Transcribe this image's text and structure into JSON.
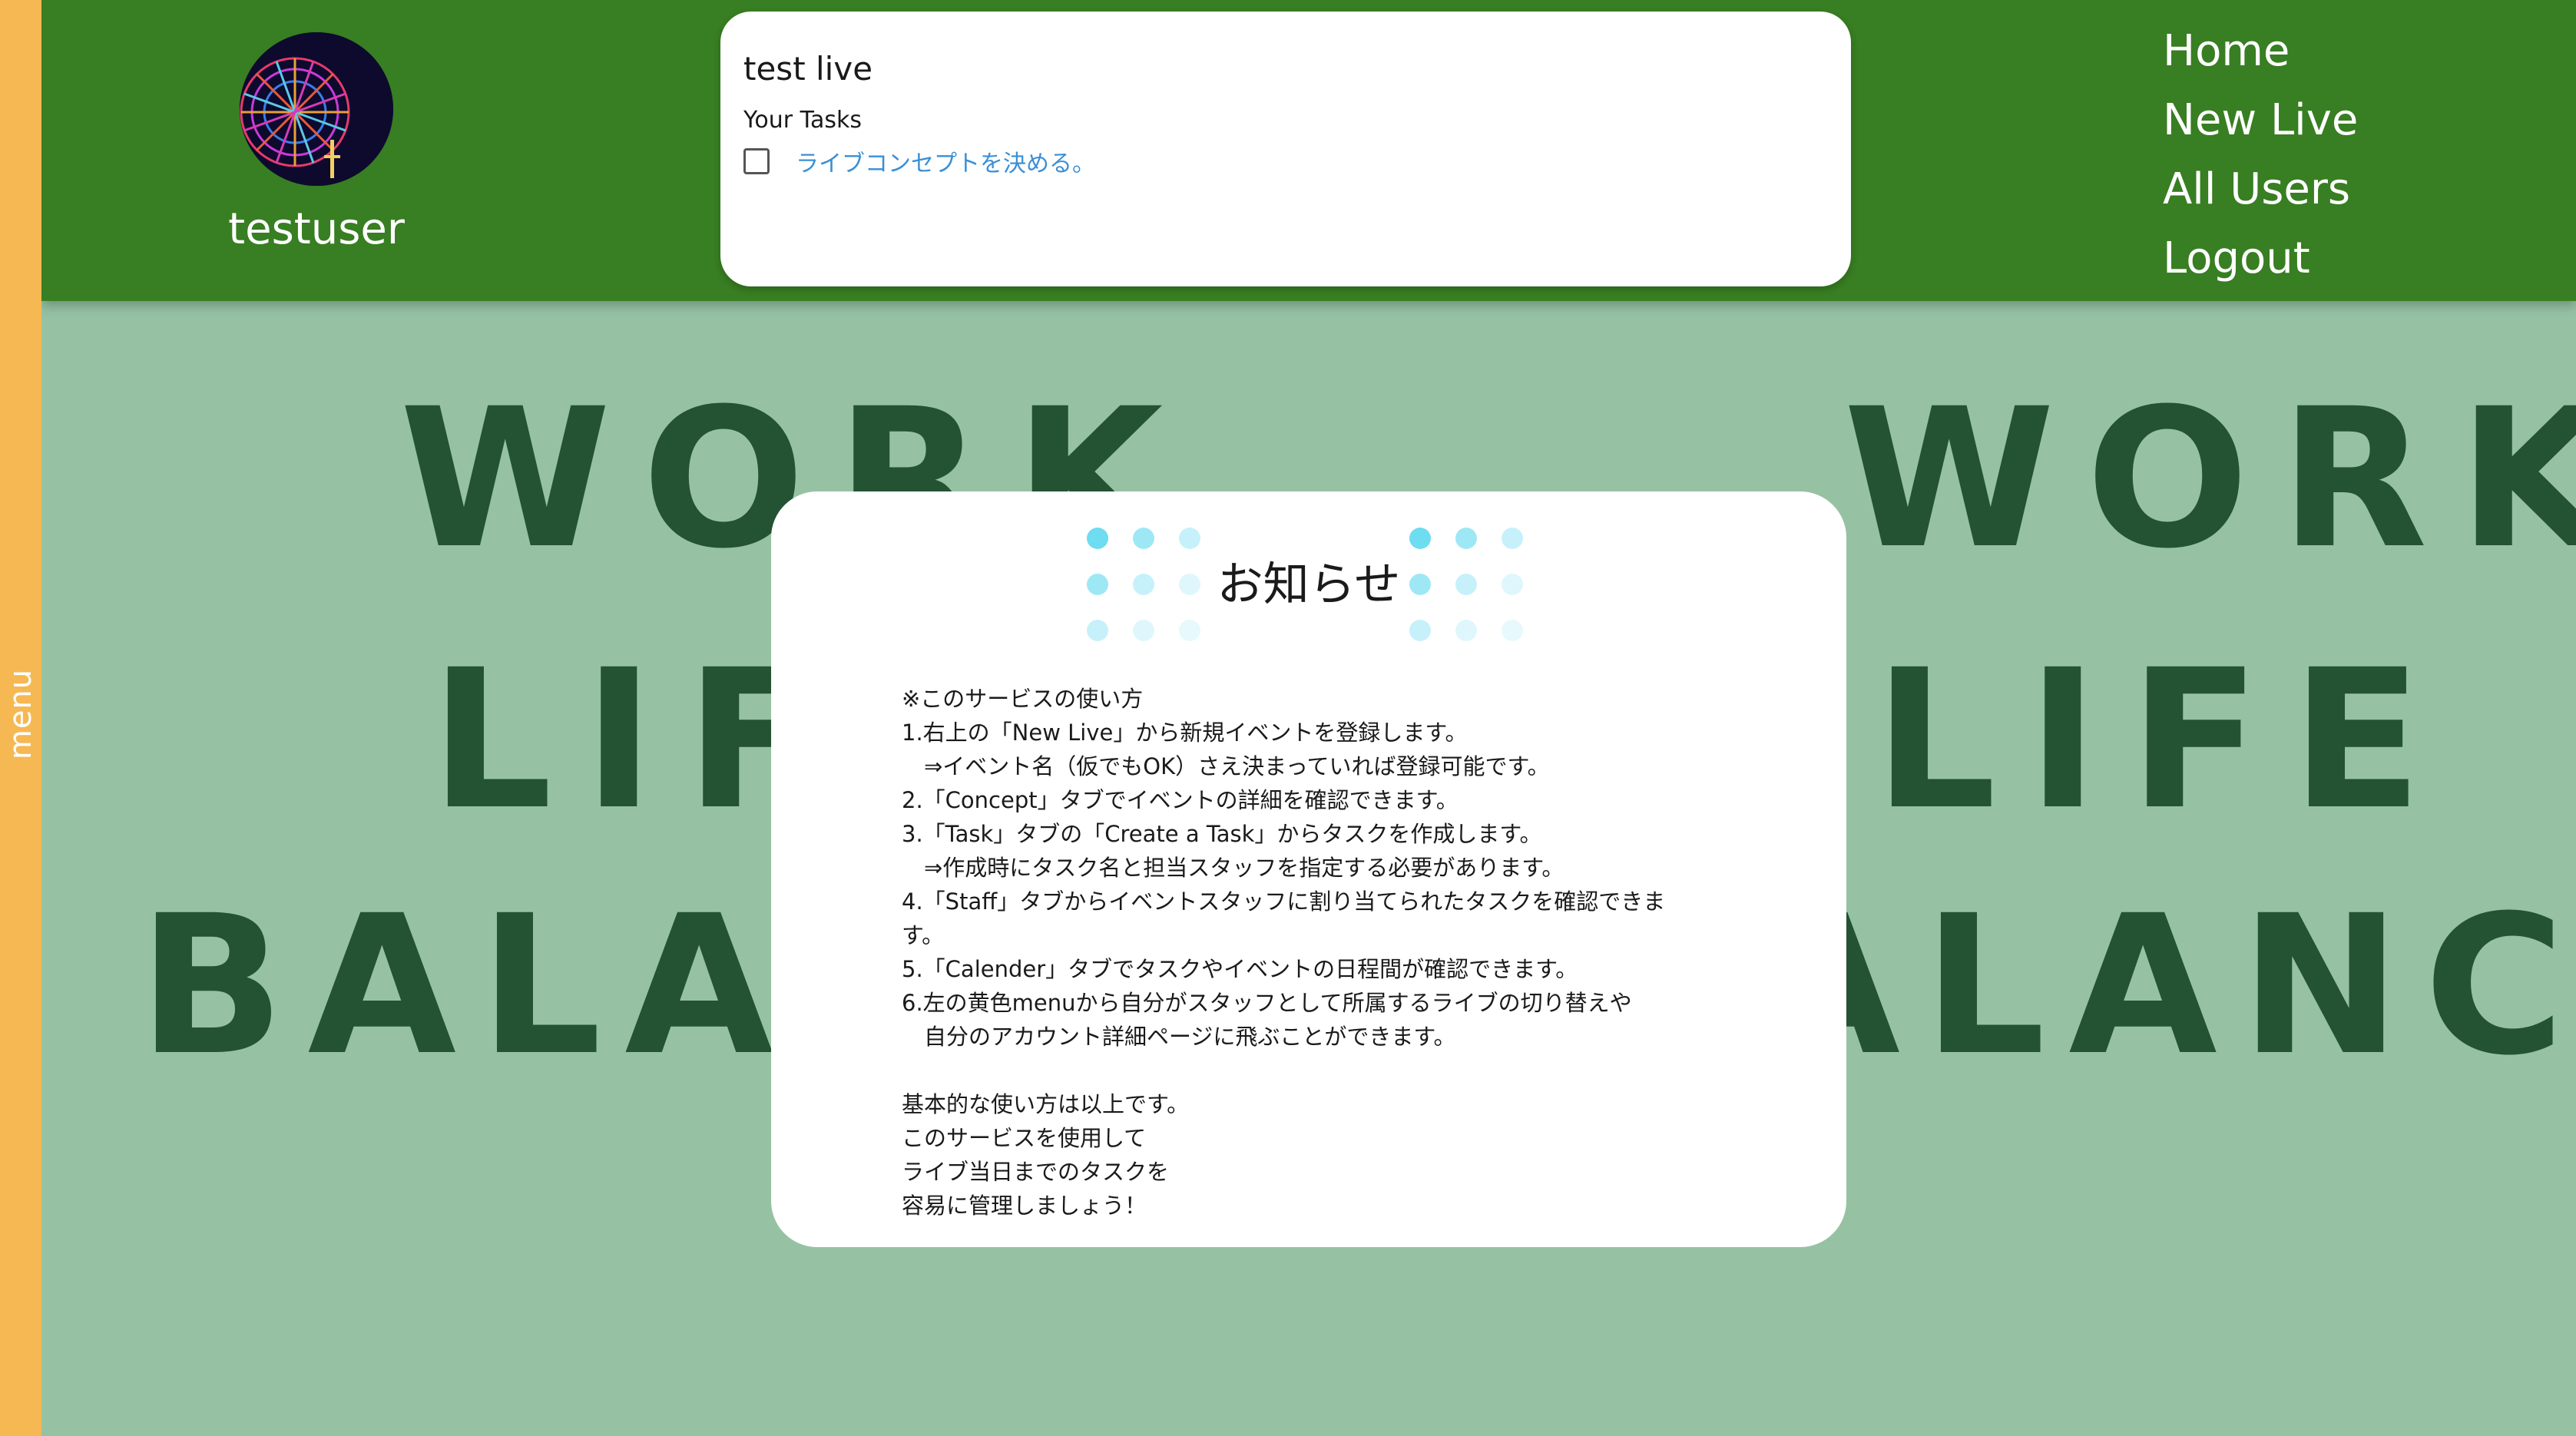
{
  "sidebar": {
    "menu_label": "menu",
    "color": "#f6b853"
  },
  "header": {
    "background": "#387e22",
    "username": "testuser",
    "nav": [
      {
        "label": "Home"
      },
      {
        "label": "New Live"
      },
      {
        "label": "All Users"
      },
      {
        "label": "Logout"
      }
    ]
  },
  "live_card": {
    "title": "test live",
    "tasks_heading": "Your Tasks",
    "tasks": [
      {
        "label": "ライブコンセプトを決める。",
        "checked": false
      }
    ]
  },
  "background_art": {
    "lines": [
      "WORK",
      "LIFE",
      "BALANCE"
    ],
    "text_color": "#235332",
    "background": "#96c2a3"
  },
  "notice": {
    "title": "お知らせ",
    "lines": [
      "※このサービスの使い方",
      "1.右上の「New Live」から新規イベントを登録します。",
      "　⇒イベント名（仮でもOK）さえ決まっていれば登録可能です。",
      "2.「Concept」タブでイベントの詳細を確認できます。",
      "3.「Task」タブの「Create a Task」からタスクを作成します。",
      "　⇒作成時にタスク名と担当スタッフを指定する必要があります。",
      "4.「Staff」タブからイベントスタッフに割り当てられたタスクを確認できま",
      "す。",
      "5.「Calender」タブでタスクやイベントの日程間が確認できます。",
      "6.左の黄色menuから自分がスタッフとして所属するライブの切り替えや",
      "　自分のアカウント詳細ページに飛ぶことができます。",
      "",
      "基本的な使い方は以上です。",
      "このサービスを使用して",
      "ライブ当日までのタスクを",
      "容易に管理しましょう！"
    ]
  }
}
